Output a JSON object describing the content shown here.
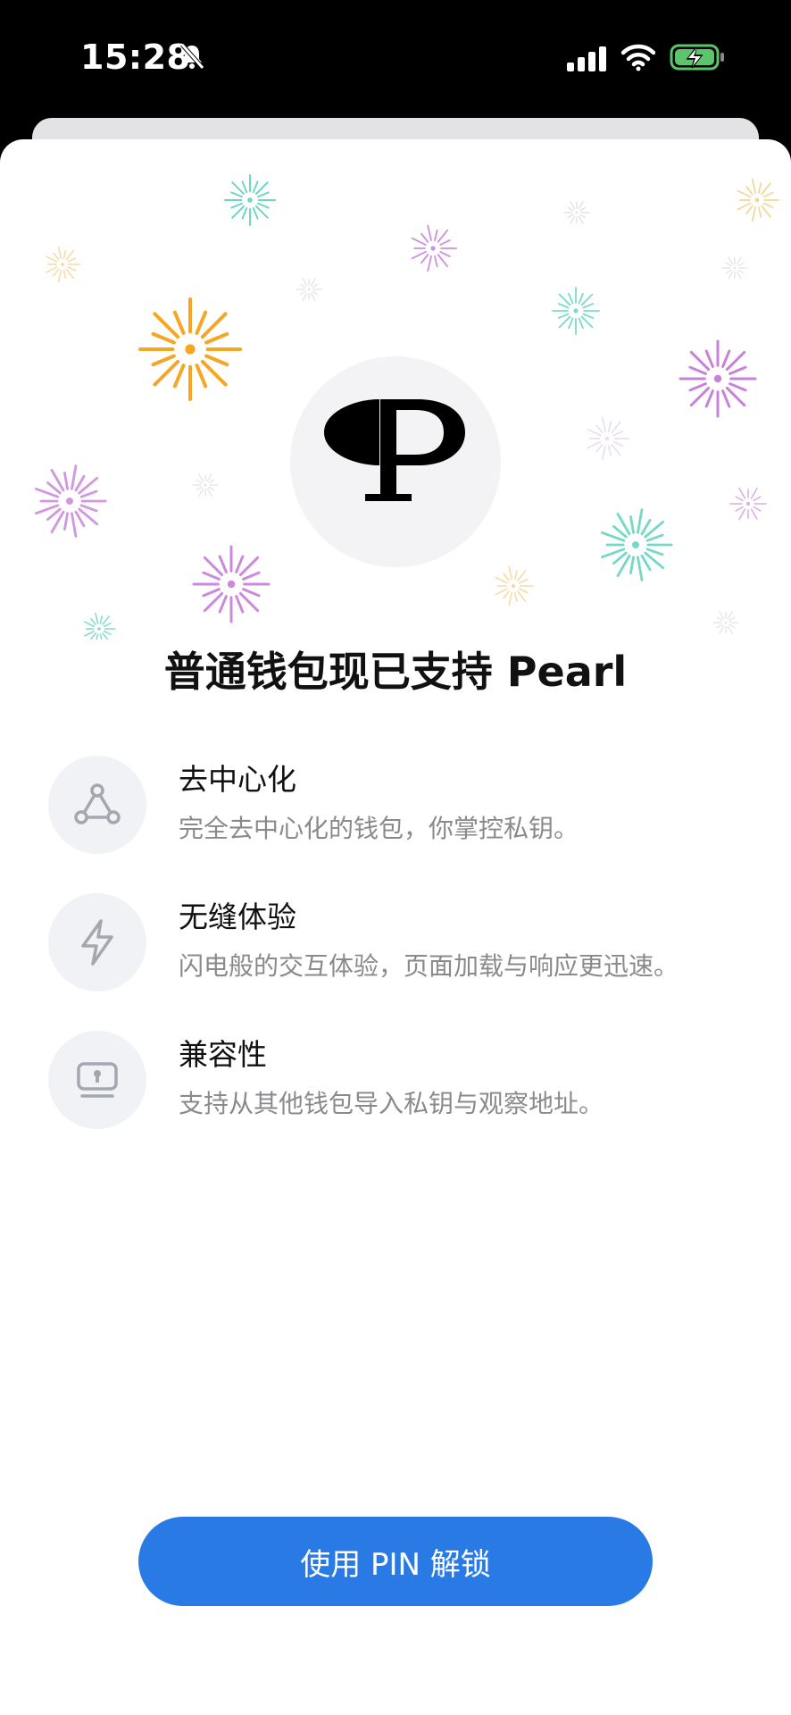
{
  "status_bar": {
    "time": "15:28"
  },
  "headline": "普通钱包现已支持 Pearl",
  "features": [
    {
      "icon": "network-icon",
      "title": "去中心化",
      "description": "完全去中心化的钱包，你掌控私钥。"
    },
    {
      "icon": "lightning-icon",
      "title": "无缝体验",
      "description": "闪电般的交互体验，页面加载与响应更迅速。"
    },
    {
      "icon": "hardware-key-icon",
      "title": "兼容性",
      "description": "支持从其他钱包导入私钥与观察地址。"
    }
  ],
  "cta": {
    "label": "使用 PIN 解锁"
  },
  "colors": {
    "accent": "#2a7ae6",
    "firework_orange": "#f5a623",
    "firework_purple": "#c276d6",
    "firework_teal": "#5fd3bd",
    "firework_yellow": "#f2c26a"
  }
}
